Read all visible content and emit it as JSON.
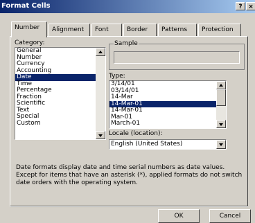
{
  "window": {
    "title": "Format Cells",
    "help_btn": "?",
    "close_btn": "×"
  },
  "tabs": [
    {
      "label": "Number",
      "active": true
    },
    {
      "label": "Alignment"
    },
    {
      "label": "Font"
    },
    {
      "label": "Border"
    },
    {
      "label": "Patterns"
    },
    {
      "label": "Protection"
    }
  ],
  "category": {
    "label": "Category:",
    "items": [
      "General",
      "Number",
      "Currency",
      "Accounting",
      "Date",
      "Time",
      "Percentage",
      "Fraction",
      "Scientific",
      "Text",
      "Special",
      "Custom"
    ],
    "selected": "Date"
  },
  "sample": {
    "label": "Sample",
    "value": ""
  },
  "type": {
    "label": "Type:",
    "items": [
      "3/14/01",
      "03/14/01",
      "14-Mar",
      "14-Mar-01",
      "14-Mar-01",
      "Mar-01",
      "March-01"
    ],
    "selected_index": 3
  },
  "locale": {
    "label": "Locale (location):",
    "value": "English (United States)"
  },
  "description": "Date formats display date and time serial numbers as date values. Except for items that have an asterisk (*), applied formats do not switch date orders with the operating system.",
  "buttons": {
    "ok": "OK",
    "cancel": "Cancel"
  }
}
